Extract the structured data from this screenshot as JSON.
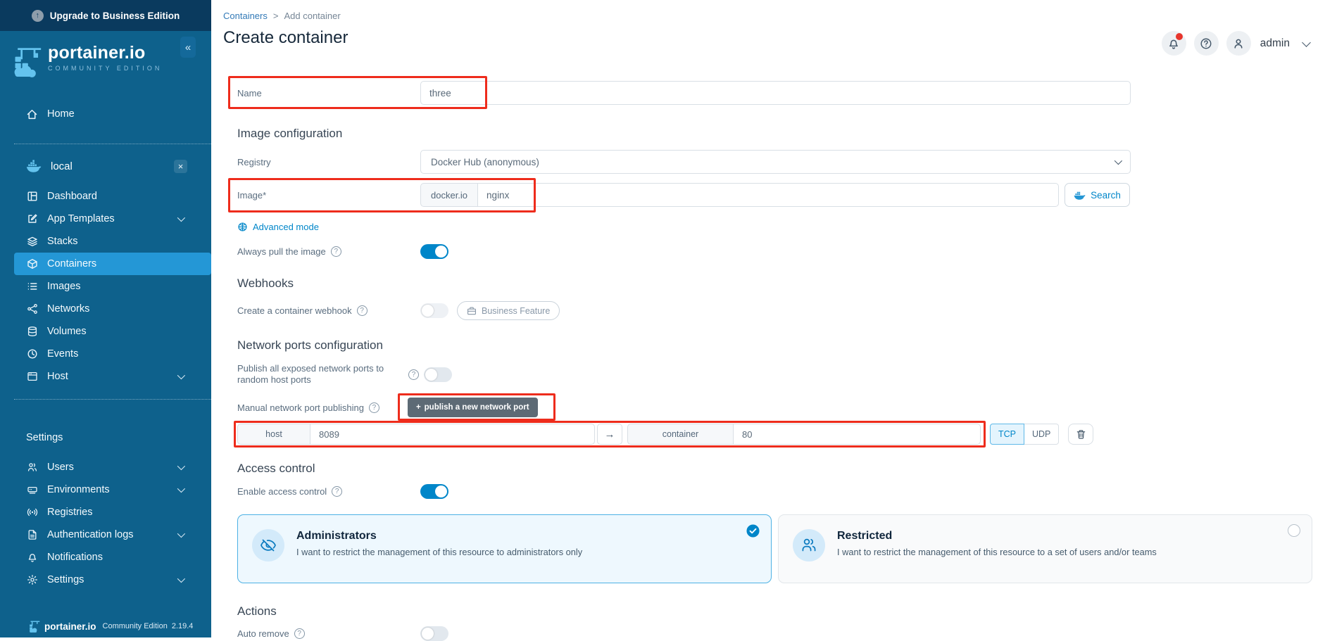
{
  "banner": {
    "label": "Upgrade to Business Edition"
  },
  "sidebar": {
    "logo_title": "portainer.io",
    "logo_subtitle": "COMMUNITY EDITION",
    "collapse_glyph": "«",
    "home_label": "Home",
    "environment": {
      "name": "local",
      "close_glyph": "×"
    },
    "env_items": [
      {
        "label": "Dashboard"
      },
      {
        "label": "App Templates"
      },
      {
        "label": "Stacks"
      },
      {
        "label": "Containers"
      },
      {
        "label": "Images"
      },
      {
        "label": "Networks"
      },
      {
        "label": "Volumes"
      },
      {
        "label": "Events"
      },
      {
        "label": "Host"
      }
    ],
    "settings_header": "Settings",
    "settings_items": [
      {
        "label": "Users"
      },
      {
        "label": "Environments"
      },
      {
        "label": "Registries"
      },
      {
        "label": "Authentication logs"
      },
      {
        "label": "Notifications"
      },
      {
        "label": "Settings"
      }
    ],
    "footer": {
      "brand": "portainer.io",
      "edition": "Community Edition",
      "version": "2.19.4"
    }
  },
  "header": {
    "breadcrumb": [
      "Containers",
      "Add container"
    ],
    "breadcrumb_sep": ">",
    "title": "Create container",
    "user": "admin"
  },
  "form": {
    "name_label": "Name",
    "name_value": "three",
    "image_config_heading": "Image configuration",
    "registry_label": "Registry",
    "registry_value": "Docker Hub (anonymous)",
    "image_label": "Image*",
    "image_prefix": "docker.io",
    "image_value": "nginx",
    "search_label": "Search",
    "advanced_mode_label": "Advanced mode",
    "always_pull_label": "Always pull the image",
    "webhooks_heading": "Webhooks",
    "webhook_label": "Create a container webhook",
    "business_feature_label": "Business Feature",
    "network_heading": "Network ports configuration",
    "publish_all_label": "Publish all exposed network ports to random host ports",
    "manual_label": "Manual network port publishing",
    "publish_btn_plus": "+",
    "publish_btn_label": "publish a new network port",
    "port": {
      "host_addon": "host",
      "host_value": "8089",
      "arrow_glyph": "→",
      "container_addon": "container",
      "container_value": "80",
      "tcp_label": "TCP",
      "udp_label": "UDP"
    },
    "access_heading": "Access control",
    "enable_access_label": "Enable access control",
    "admin_card": {
      "title": "Administrators",
      "desc": "I want to restrict the management of this resource to administrators only"
    },
    "restricted_card": {
      "title": "Restricted",
      "desc": "I want to restrict the management of this resource to a set of users and/or teams"
    },
    "actions_heading": "Actions",
    "auto_remove_label": "Auto remove"
  },
  "colors": {
    "accent_blue": "#0086c9",
    "annotation_red": "#ee2c1c",
    "sidebar_bg": "#0e618c",
    "banner_bg": "#0a3a5e",
    "selected_item_bg": "#2497d6"
  }
}
